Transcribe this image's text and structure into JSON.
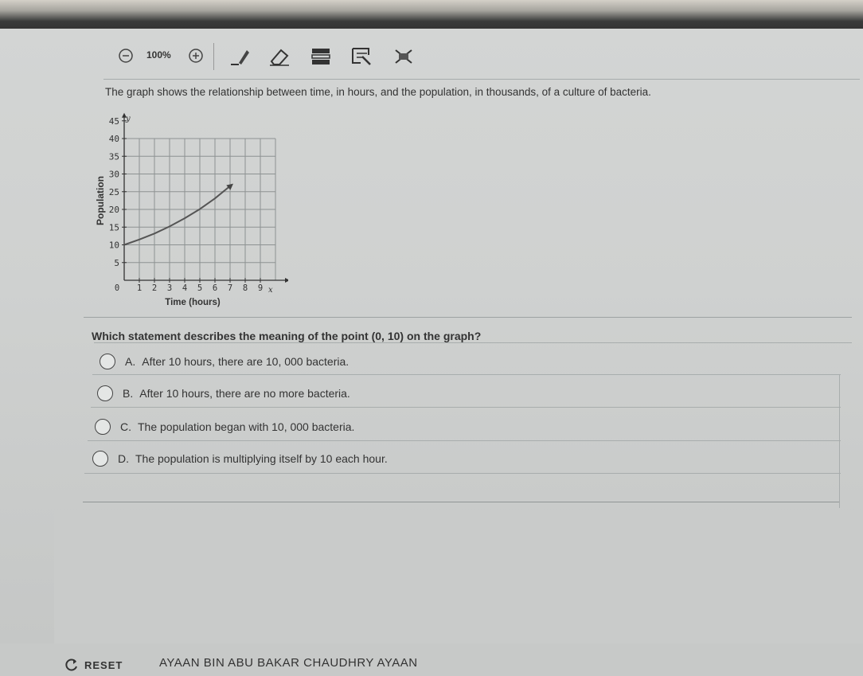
{
  "toolbar": {
    "zoom_label": "100%",
    "icons": [
      "zoom-out-icon",
      "zoom-in-icon",
      "pen-icon",
      "eraser-icon",
      "line-reader-icon",
      "highlight-icon",
      "eliminate-choice-icon"
    ]
  },
  "question": {
    "intro": "The graph shows the relationship between time, in hours, and the population, in thousands, of a culture of bacteria.",
    "prompt": "Which statement describes the meaning of the point (0, 10) on the graph?",
    "options": [
      {
        "letter": "A.",
        "text": "After 10 hours, there are 10, 000 bacteria."
      },
      {
        "letter": "B.",
        "text": "After 10 hours, there are no more bacteria."
      },
      {
        "letter": "C.",
        "text": "The population began with 10, 000 bacteria."
      },
      {
        "letter": "D.",
        "text": "The population is multiplying itself by 10 each hour."
      }
    ]
  },
  "chart_data": {
    "type": "line",
    "xlabel": "Time (hours)",
    "ylabel": "Population",
    "x_axis_letter": "x",
    "y_axis_letter": "y",
    "xlim": [
      0,
      10
    ],
    "ylim": [
      0,
      45
    ],
    "x_ticks": [
      "0",
      "1",
      "2",
      "3",
      "4",
      "5",
      "6",
      "7",
      "8",
      "9"
    ],
    "y_ticks": [
      "5",
      "10",
      "15",
      "20",
      "25",
      "30",
      "35",
      "40",
      "45"
    ],
    "grid": true,
    "series": [
      {
        "x": [
          0,
          1,
          2,
          3,
          4,
          5,
          6,
          7
        ],
        "y": [
          10,
          11.5,
          13.2,
          15.2,
          17.5,
          20.1,
          23.1,
          26.6
        ]
      }
    ]
  },
  "footer": {
    "reset_label": "RESET",
    "student_name": "AYAAN BIN ABU BAKAR CHAUDHRY AYAAN"
  }
}
